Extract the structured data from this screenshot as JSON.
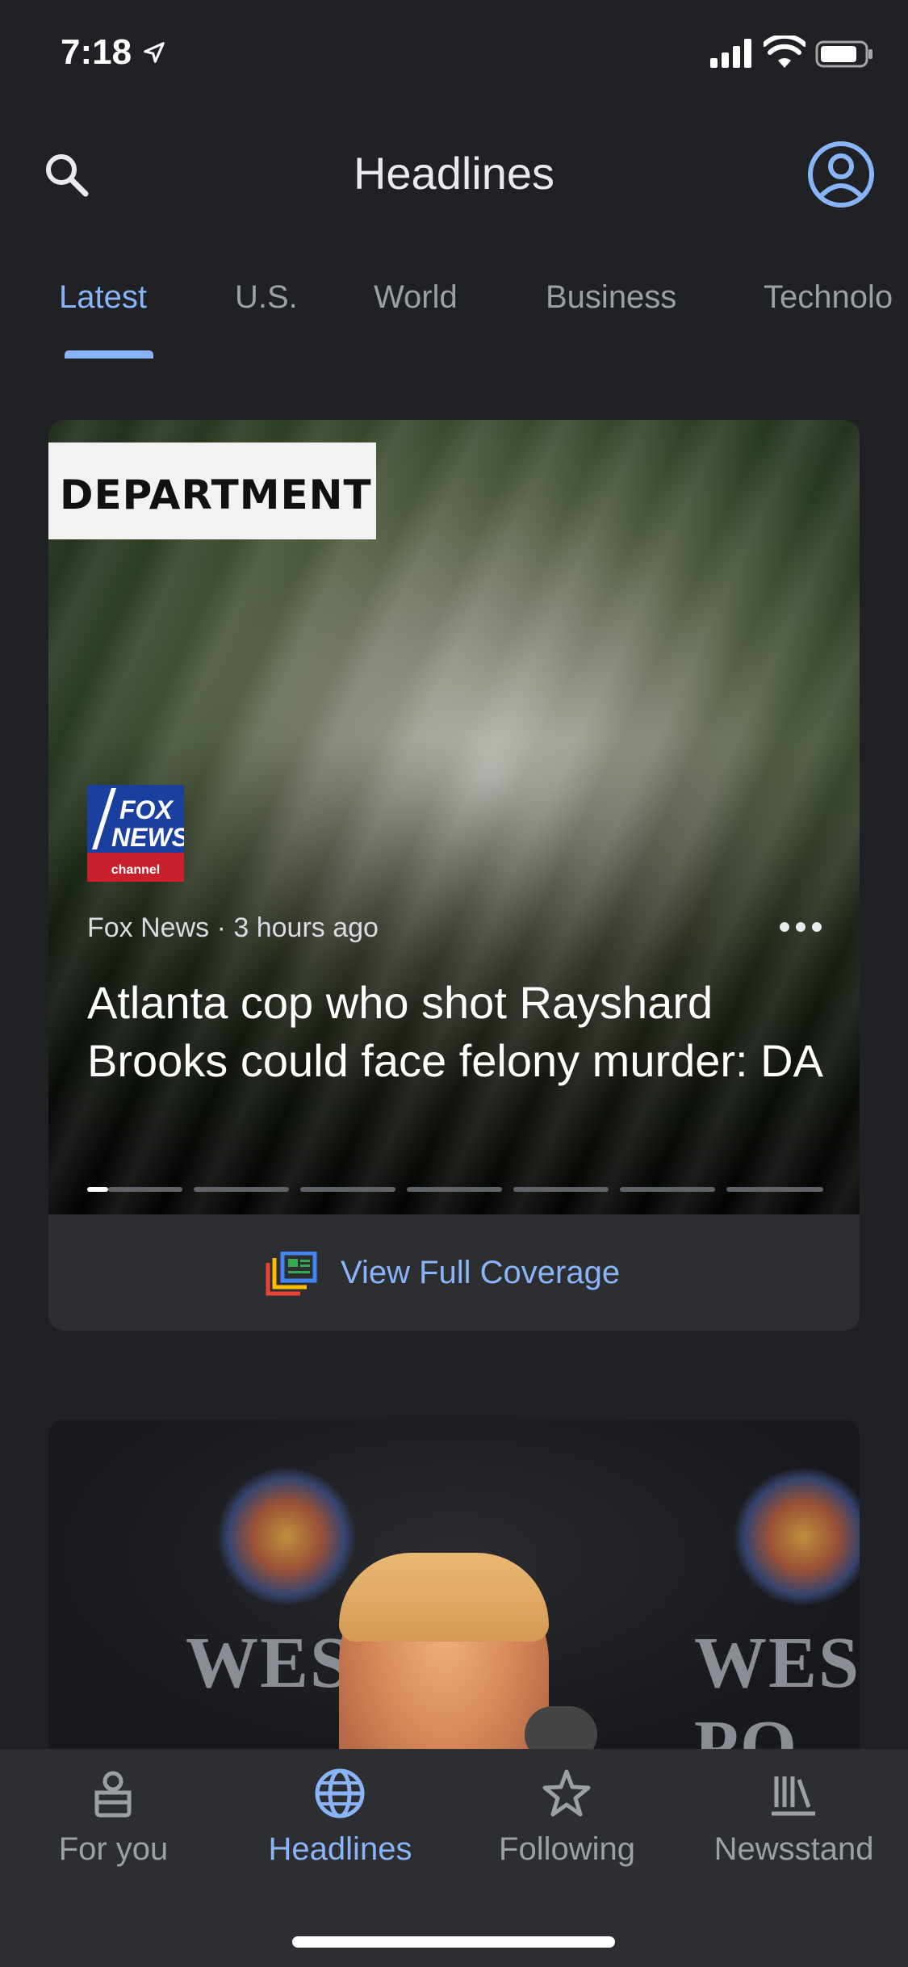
{
  "status_bar": {
    "time": "7:18"
  },
  "header": {
    "title": "Headlines"
  },
  "tabs": [
    {
      "label": "Latest",
      "active": true
    },
    {
      "label": "U.S.",
      "active": false
    },
    {
      "label": "World",
      "active": false
    },
    {
      "label": "Business",
      "active": false
    },
    {
      "label": "Technolo",
      "active": false
    }
  ],
  "story": {
    "image_text": "DEPARTMENT",
    "logo_lines": [
      "FOX",
      "NEWS",
      "channel"
    ],
    "meta": "Fox News · 3 hours ago",
    "headline": "Atlanta cop who shot Rayshard Brooks could face felony murder: DA",
    "progress": {
      "current": 1,
      "total": 7
    },
    "coverage_label": "View Full Coverage"
  },
  "story2": {
    "image_text": "WEST PO"
  },
  "bottom_nav": [
    {
      "label": "For you",
      "icon": "for-you-icon",
      "active": false
    },
    {
      "label": "Headlines",
      "icon": "globe-icon",
      "active": true
    },
    {
      "label": "Following",
      "icon": "star-icon",
      "active": false
    },
    {
      "label": "Newsstand",
      "icon": "newsstand-icon",
      "active": false
    }
  ],
  "colors": {
    "accent": "#8ab4f8",
    "background": "#202124",
    "surface": "#2d2e31",
    "muted": "#9aa0a6"
  }
}
